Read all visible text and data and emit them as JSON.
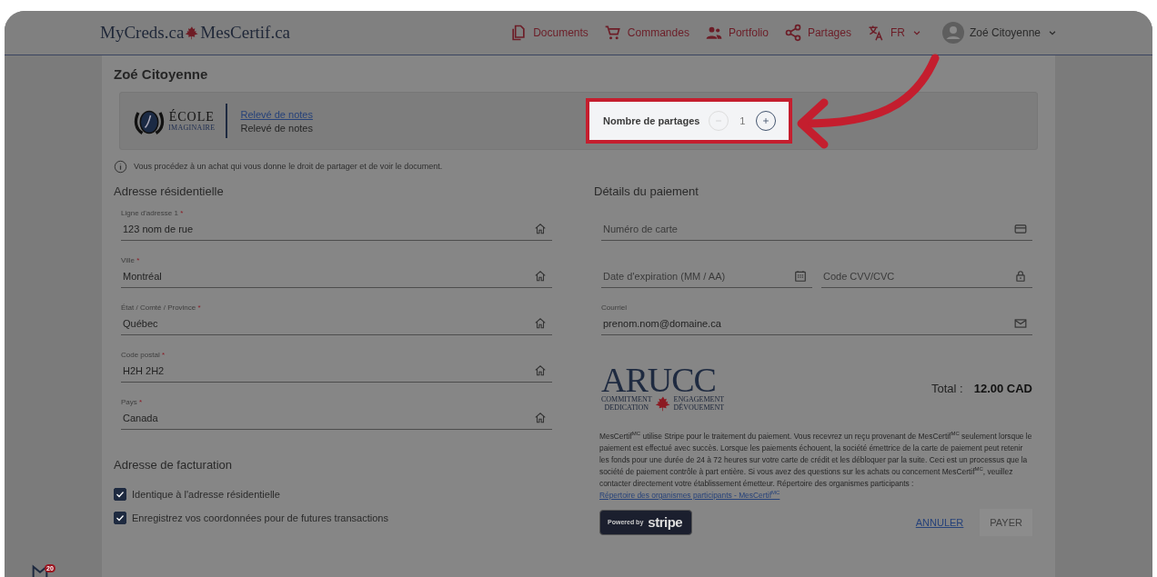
{
  "header": {
    "logo_left": "MyCreds.ca",
    "logo_right": "MesCertif.ca",
    "nav": [
      {
        "kind": "documents",
        "label": "Documents"
      },
      {
        "kind": "orders",
        "label": "Commandes"
      },
      {
        "kind": "portfolio",
        "label": "Portfolio"
      },
      {
        "kind": "shares",
        "label": "Partages"
      }
    ],
    "language": "FR",
    "user": "Zoé Citoyenne"
  },
  "page_title": "Zoé Citoyenne",
  "document": {
    "school_name": "ÉCOLE",
    "school_subtitle": "IMAGINAIRE",
    "link": "Relevé de notes",
    "subtitle": "Relevé de notes",
    "share_counter": {
      "label": "Nombre de partages",
      "value": "1",
      "minus_disabled": true,
      "highlighted": true
    }
  },
  "info": "Vous procédez à un achat qui vous donne le droit de partager et de voir le document.",
  "residential": {
    "title": "Adresse résidentielle",
    "fields": [
      {
        "label": "Ligne d'adresse 1",
        "mark": "*",
        "value": "123 nom de rue"
      },
      {
        "label": "Ville",
        "mark": "*",
        "value": "Montréal"
      },
      {
        "label": "État / Comté / Province",
        "mark": "*",
        "value": "Québec"
      },
      {
        "label": "Code postal",
        "mark": "*",
        "value": "H2H 2H2"
      },
      {
        "label": "Pays",
        "mark": "*",
        "value": "Canada"
      }
    ]
  },
  "billing": {
    "title": "Adresse de facturation",
    "options": [
      {
        "label": "Identique à l'adresse résidentielle",
        "checked": true
      },
      {
        "label": "Enregistrez vos coordonnées pour de futures transactions",
        "checked": true
      }
    ]
  },
  "payment": {
    "title": "Détails du paiement",
    "card_number": {
      "placeholder": "Numéro de carte"
    },
    "expiry": {
      "placeholder": "Date d'expiration (MM / AA)"
    },
    "cvc": {
      "placeholder": "Code CVV/CVC"
    },
    "email": {
      "label": "Courriel",
      "value": "prenom.nom@domaine.ca"
    },
    "logo": {
      "name": "ARUCC",
      "tag_1": "COMMITMENT",
      "tag_2": "DEDICATION",
      "tag_3": "ENGAGEMENT",
      "tag_4": "DÉVOUEMENT"
    },
    "total_label": "Total :",
    "total_value": "12.00 CAD",
    "notice": "MesCertif$^{MC}$ utilise Stripe pour le traitement du paiement. Vous recevrez un reçu provenant de MesCertif$^{MC}$ seulement lorsque le paiement est effectué avec succès. Lorsque les paiements échouent, la société émettrice de la carte de paiement peut retenir les fonds pour une durée de 24 à 72 heures sur votre carte de crédit et les débloquer par la suite. Ceci est un processus que la société de paiement contrôle à part entière. Si vous avez des questions sur les achats ou concernent MesCertif$^{MC}$, veuillez contacter directement votre établissement émetteur. Répertoire des organismes participants :",
    "notice_link": "Répertoire des organismes participants - MesCertif$^{MC}$",
    "stripe": {
      "lead": "Powered by",
      "brand": "stripe"
    },
    "cancel": "ANNULER",
    "pay": {
      "label": "PAYER",
      "disabled": true
    }
  },
  "corner_badge": "20"
}
